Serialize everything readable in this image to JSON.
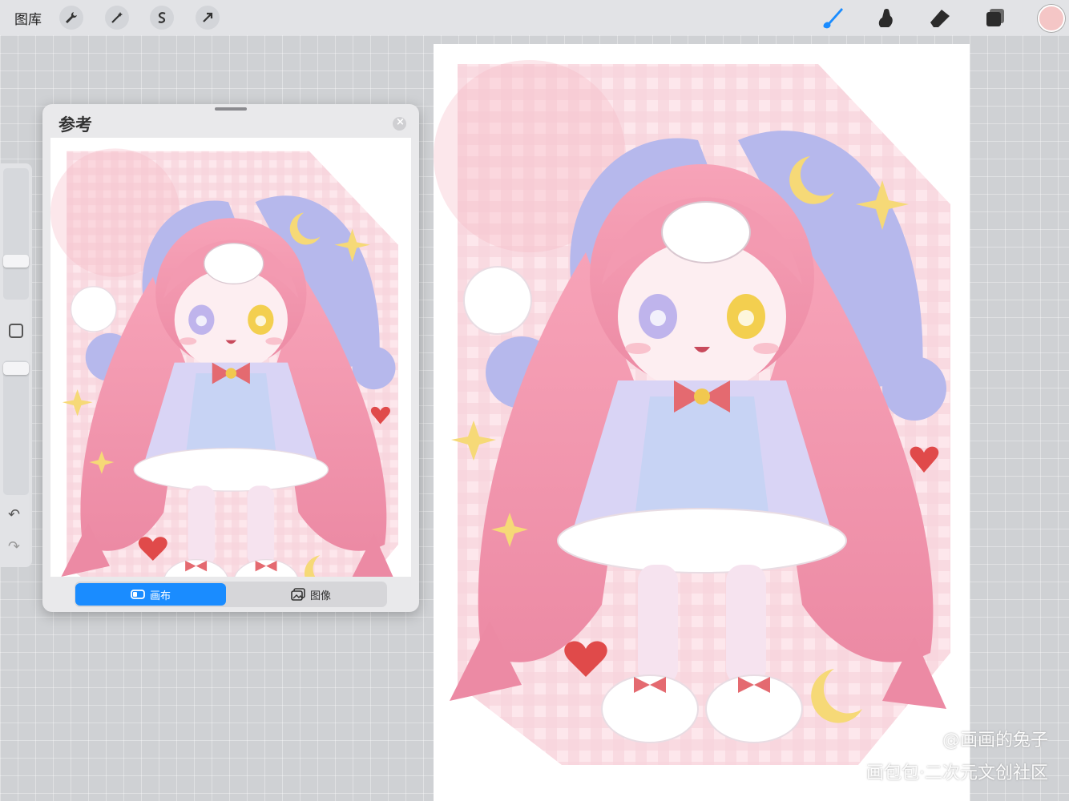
{
  "toolbar": {
    "gallery_label": "图库",
    "left_tools": [
      "wrench-icon",
      "magic-wand-icon",
      "selection-icon",
      "transform-arrow-icon"
    ],
    "right_tools": [
      "brush-icon",
      "smudge-icon",
      "eraser-icon",
      "layers-icon"
    ],
    "current_color": "#f4c6c6",
    "accent": "#1a8cff"
  },
  "reference_panel": {
    "title": "参考",
    "tabs": [
      {
        "label": "画布",
        "active": true
      },
      {
        "label": "图像",
        "active": false
      }
    ]
  },
  "watermark": {
    "author": "@画画的兔子",
    "community": "画包包·二次元文创社区"
  }
}
